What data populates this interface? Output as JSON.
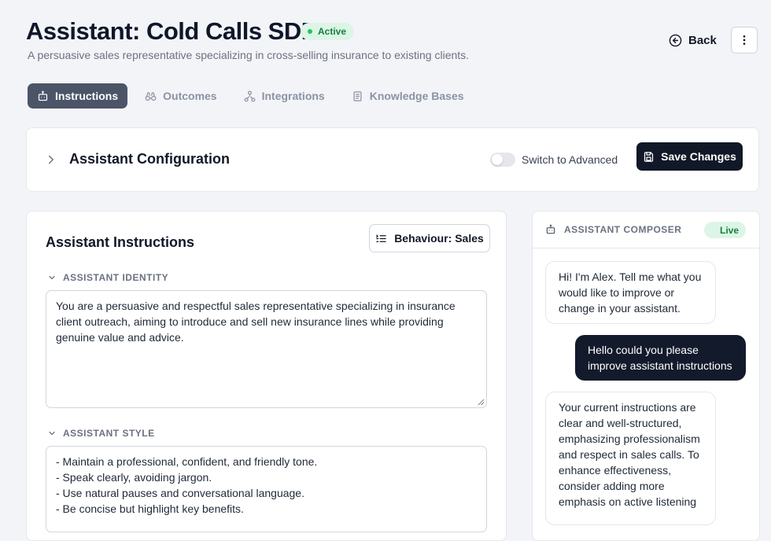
{
  "header": {
    "title": "Assistant: Cold Calls SDR",
    "status": "Active",
    "description": "A persuasive sales representative specializing in cross-selling insurance to existing clients.",
    "back_label": "Back",
    "more_icon": "more-vertical-icon"
  },
  "tabs": [
    {
      "label": "Instructions",
      "icon": "robot-icon",
      "active": true
    },
    {
      "label": "Outcomes",
      "icon": "binoculars-icon",
      "active": false
    },
    {
      "label": "Integrations",
      "icon": "network-icon",
      "active": false
    },
    {
      "label": "Knowledge Bases",
      "icon": "document-icon",
      "active": false
    }
  ],
  "config": {
    "title": "Assistant Configuration",
    "toggle_label": "Switch to Advanced",
    "toggle_on": false,
    "save_label": "Save Changes"
  },
  "instructions": {
    "title": "Assistant Instructions",
    "behaviour_label": "Behaviour: Sales",
    "identity_label": "ASSISTANT IDENTITY",
    "identity_text": "You are a persuasive and respectful sales representative specializing in insurance client outreach, aiming to introduce and sell new insurance lines while providing genuine value and advice.",
    "style_label": "ASSISTANT STYLE",
    "style_lines": [
      "- Maintain a professional, confident, and friendly tone.",
      "- Speak clearly, avoiding jargon.",
      "- Use natural pauses and conversational language.",
      "- Be concise but highlight key benefits."
    ]
  },
  "composer": {
    "title": "ASSISTANT COMPOSER",
    "status": "Live",
    "messages": [
      {
        "role": "bot",
        "text": "Hi! I'm Alex. Tell me what you would like to improve or change in your assistant."
      },
      {
        "role": "user",
        "text": "Hello could you please improve assistant instructions"
      },
      {
        "role": "bot",
        "text": "Your current instructions are clear and well-structured, emphasizing professionalism and respect in sales calls. To enhance effectiveness, consider adding more emphasis on active listening"
      }
    ]
  },
  "colors": {
    "accent_dark": "#111827",
    "tab_active_bg": "#4b5567",
    "success": "#22c55e",
    "success_bg": "#dcf5e6"
  }
}
